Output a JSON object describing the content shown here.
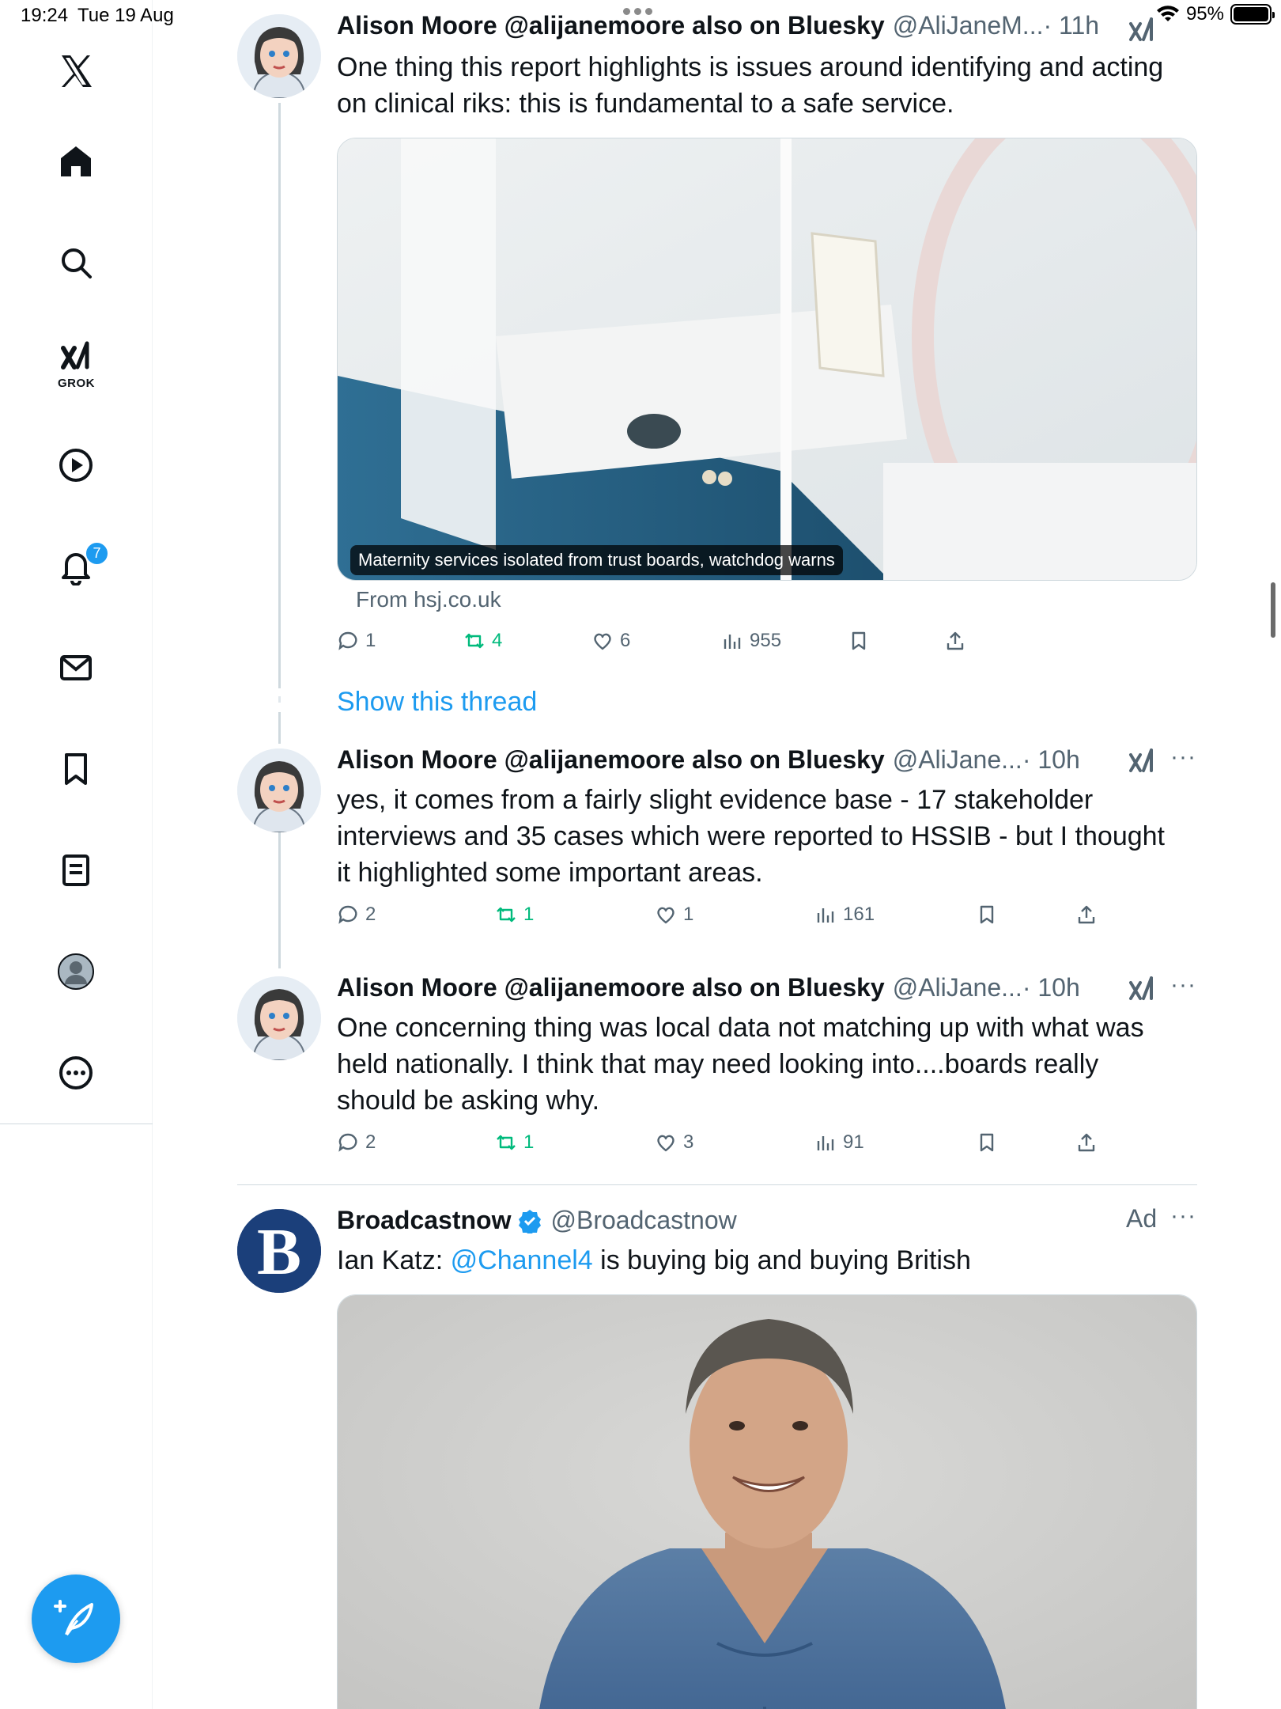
{
  "status_bar": {
    "time": "19:24",
    "date": "Tue 19 Aug",
    "battery": "95%"
  },
  "sidebar": {
    "grok_label": "GROK",
    "notification_count": "7",
    "items": [
      "x-logo",
      "home",
      "search",
      "grok",
      "video",
      "notifications",
      "messages",
      "bookmarks",
      "lists",
      "profile",
      "more"
    ]
  },
  "tweets": [
    {
      "name": "Alison Moore @alijanemoore also on Bluesky",
      "handle": "@AliJaneM...",
      "time": "· 11h",
      "text": "One thing this report highlights is issues around identifying and acting on clinical riks: this is fundamental to a safe service.",
      "card_caption": "Maternity services isolated from trust boards, watchdog warns",
      "card_source": "From hsj.co.uk",
      "replies": "1",
      "reposts": "4",
      "likes": "6",
      "views": "955"
    },
    {
      "name": "Alison Moore @alijanemoore also on Bluesky",
      "handle": "@AliJane...",
      "time": "· 10h",
      "text": "yes, it comes from a fairly slight evidence base - 17 stakeholder interviews and 35 cases which were reported to HSSIB - but I thought it highlighted some important areas.",
      "replies": "2",
      "reposts": "1",
      "likes": "1",
      "views": "161"
    },
    {
      "name": "Alison Moore @alijanemoore also on Bluesky",
      "handle": "@AliJane...",
      "time": "· 10h",
      "text": "One concerning thing was local data not matching up with what was held nationally. I think that may need looking into....boards really should be asking why.",
      "replies": "2",
      "reposts": "1",
      "likes": "3",
      "views": "91"
    }
  ],
  "show_thread": "Show this thread",
  "ad": {
    "name": "Broadcastnow",
    "handle": "@Broadcastnow",
    "label": "Ad",
    "avatar_letter": "B",
    "text_prefix": "Ian Katz: ",
    "mention": "@Channel4",
    "text_suffix": " is buying big and buying British"
  },
  "colors": {
    "accent": "#1d9bf0",
    "repost": "#00ba7c",
    "muted": "#536471"
  }
}
